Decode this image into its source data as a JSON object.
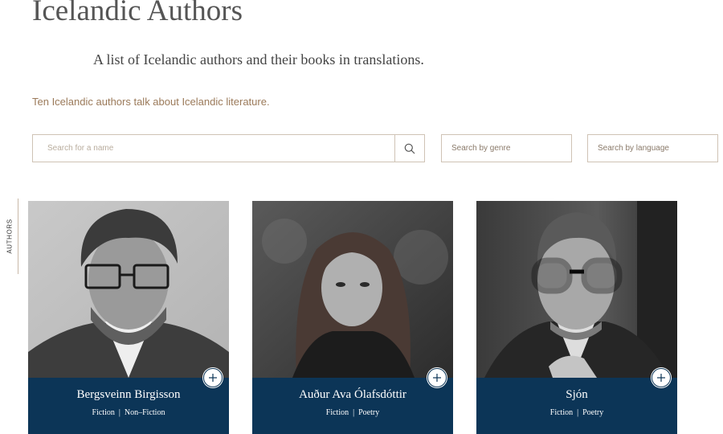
{
  "header": {
    "title": "Icelandic Authors",
    "subtitle": "A list of Icelandic authors and their books in translations.",
    "intro_link": "Ten Icelandic authors talk about Icelandic literature."
  },
  "filters": {
    "name_placeholder": "Search for a name",
    "genre_label": "Search by genre",
    "language_label": "Search by language"
  },
  "side_tab": {
    "label": "AUTHORS"
  },
  "authors": [
    {
      "name": "Bergsveinn Birgisson",
      "genres": [
        "Fiction",
        "Non–Fiction"
      ]
    },
    {
      "name": "Auður Ava Ólafsdóttir",
      "genres": [
        "Fiction",
        "Poetry"
      ]
    },
    {
      "name": "Sjón",
      "genres": [
        "Fiction",
        "Poetry"
      ]
    }
  ],
  "colors": {
    "card_band": "#0c3557",
    "accent_link": "#9b7a5a",
    "input_border": "#cfc3b5"
  }
}
